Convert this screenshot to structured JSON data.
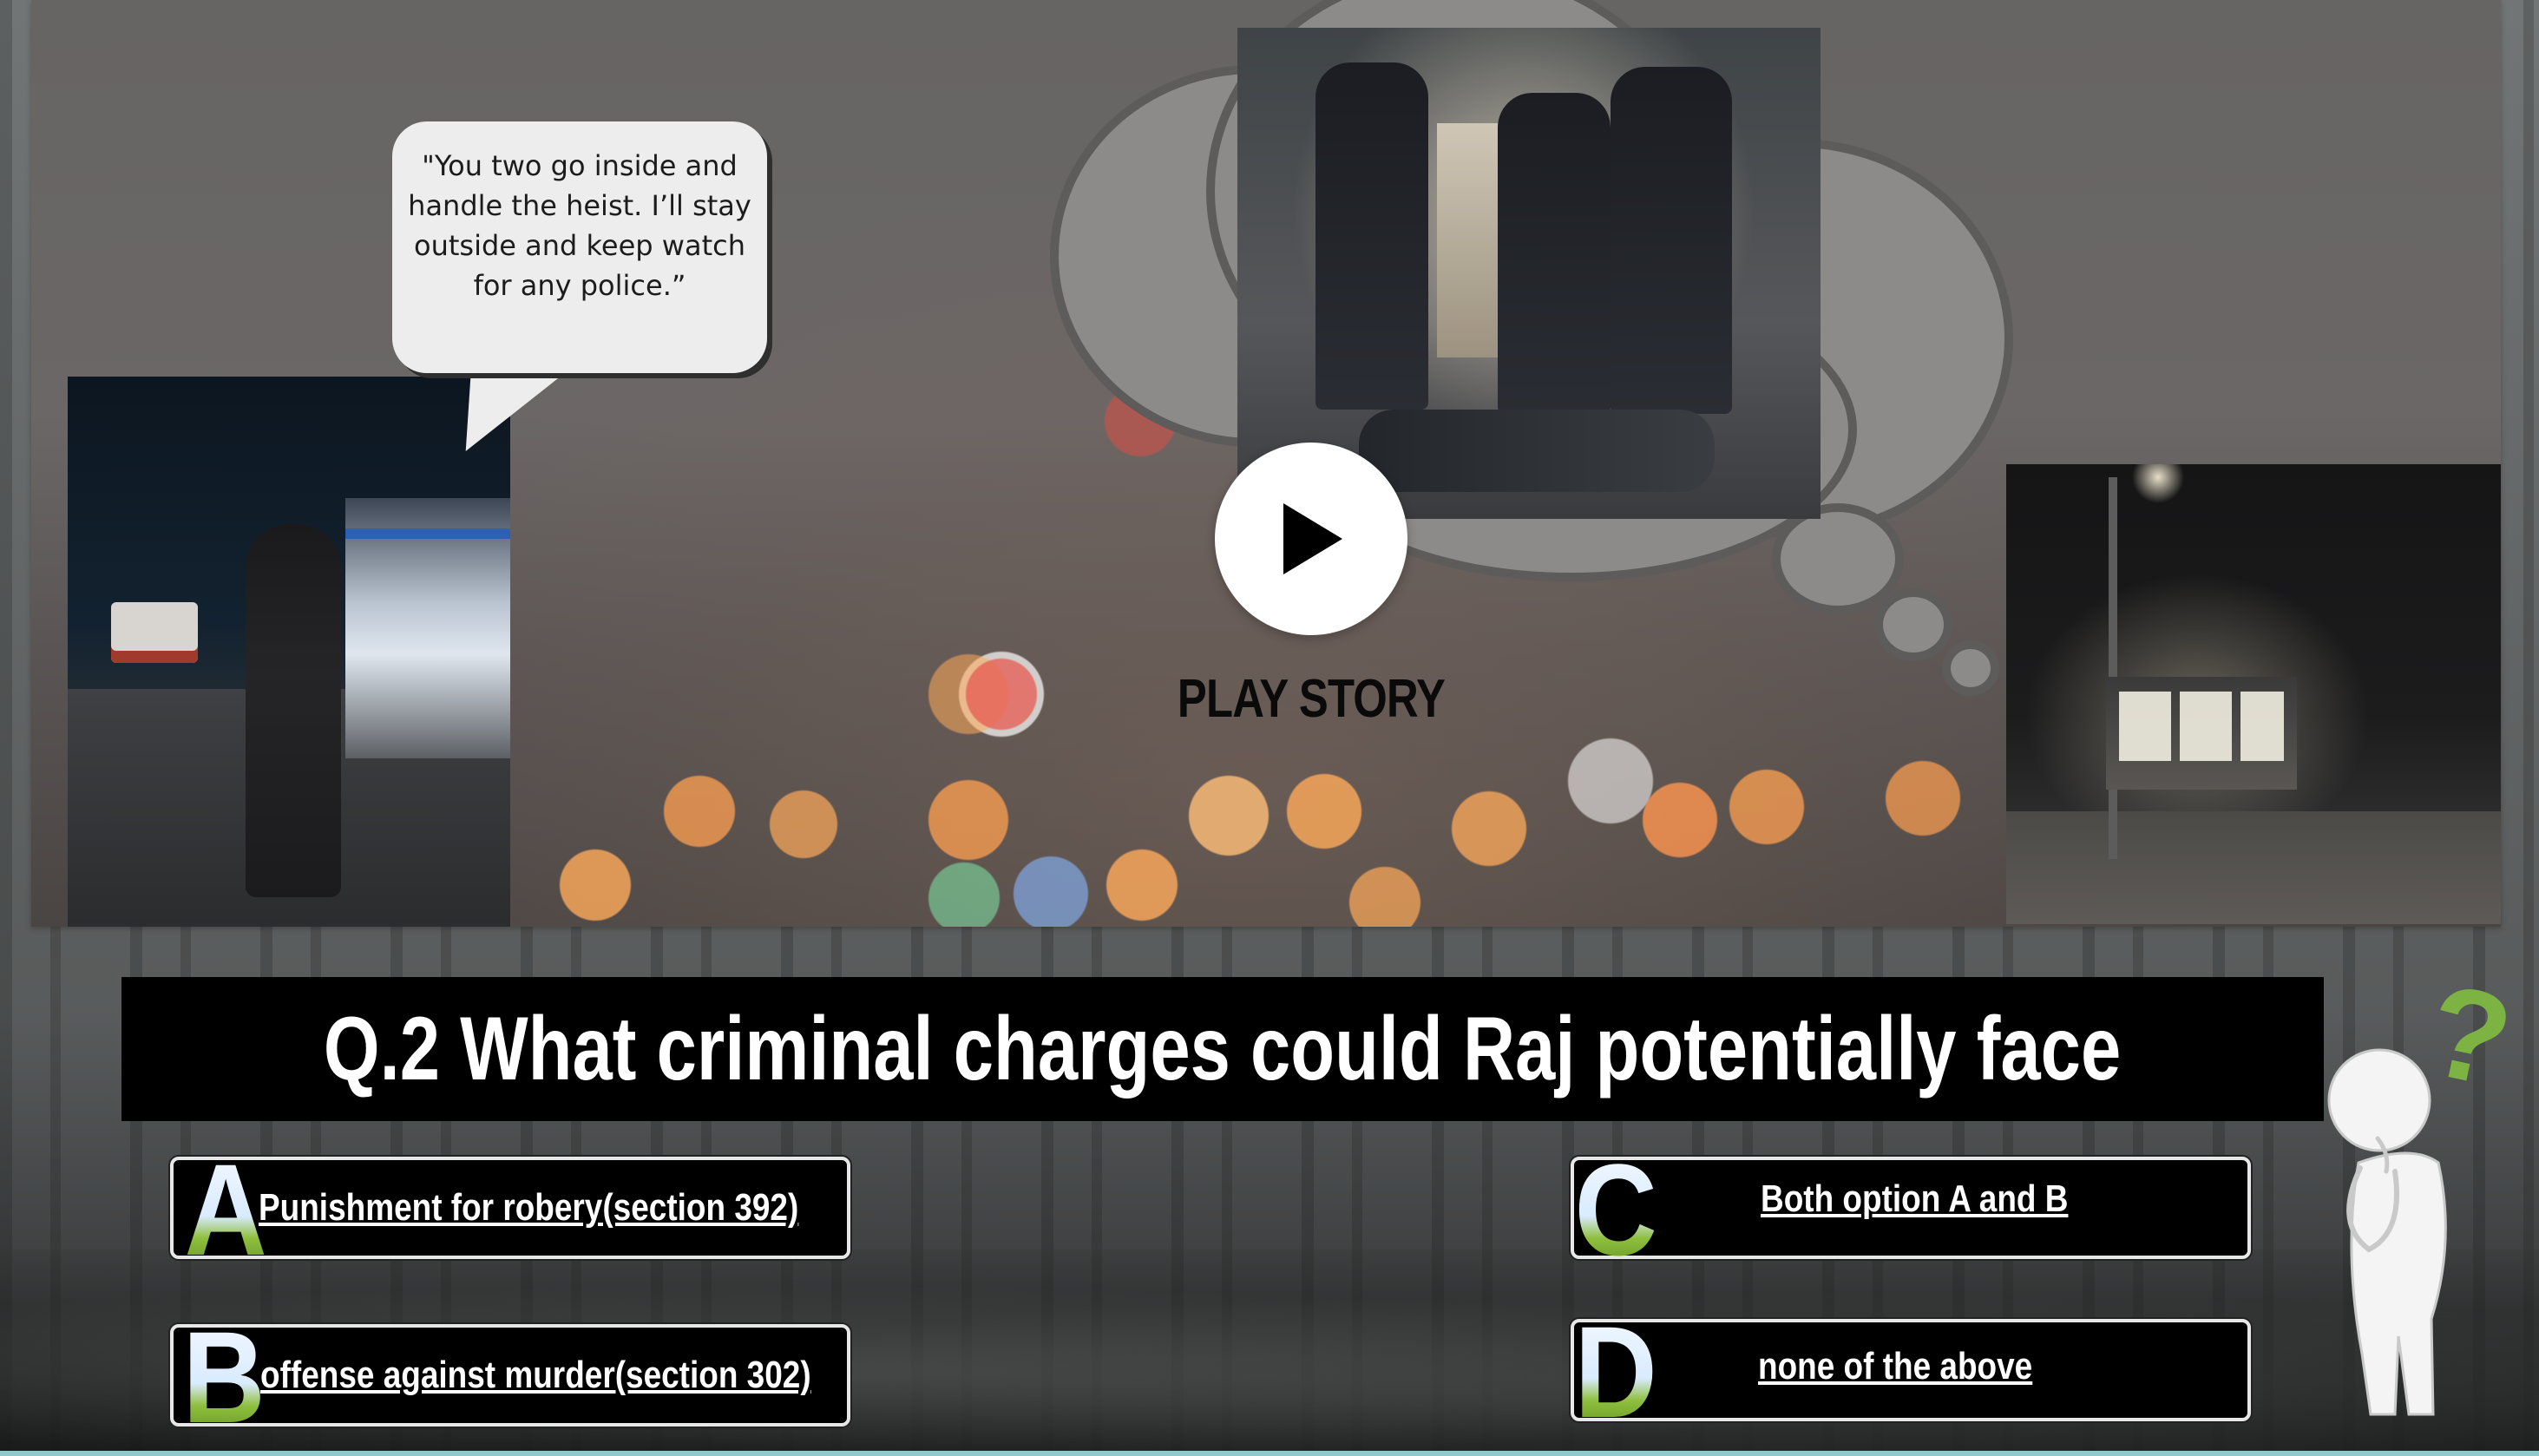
{
  "story": {
    "speech_text": "\"You two go inside and handle the heist. I’ll stay outside and keep watch for any police.”",
    "play_label": "PLAY STORY"
  },
  "question": {
    "text": "Q.2 What criminal charges could Raj potentially face"
  },
  "options": [
    {
      "letter": "A",
      "text": "Punishment for robery(section 392)"
    },
    {
      "letter": "B",
      "text": "offense against murder(section 302)"
    },
    {
      "letter": "C",
      "text": "Both option A and B"
    },
    {
      "letter": "D",
      "text": "none of the above"
    }
  ],
  "decor": {
    "question_mark": "?",
    "accent_green": "#7cb342",
    "bottom_rule": "#8fc9c9"
  }
}
